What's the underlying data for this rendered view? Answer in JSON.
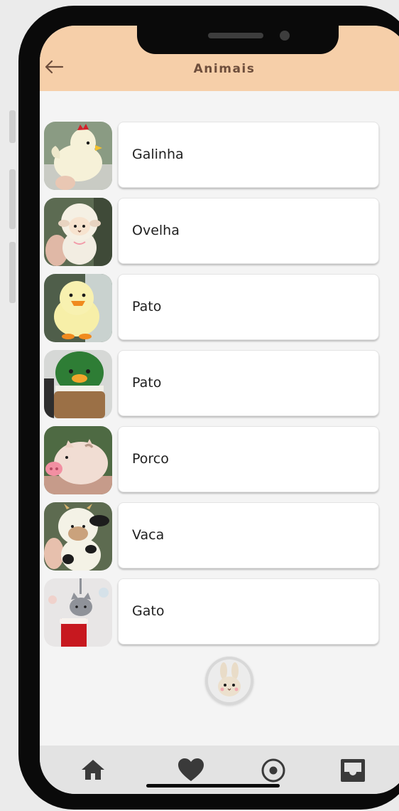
{
  "header": {
    "title": "Animais"
  },
  "list": {
    "items": [
      {
        "label": "Galinha"
      },
      {
        "label": "Ovelha"
      },
      {
        "label": "Pato"
      },
      {
        "label": "Pato"
      },
      {
        "label": "Porco"
      },
      {
        "label": "Vaca"
      },
      {
        "label": "Gato"
      }
    ]
  },
  "bottom_nav": {
    "items": [
      {
        "icon": "home-icon"
      },
      {
        "icon": "heart-icon"
      },
      {
        "icon": "record-icon"
      },
      {
        "icon": "inbox-icon"
      }
    ]
  },
  "colors": {
    "header_bg": "#f6cfa9",
    "title": "#6e4e3c",
    "nav_bg": "#e3e3e3",
    "nav_icon": "#3a3a3a"
  }
}
